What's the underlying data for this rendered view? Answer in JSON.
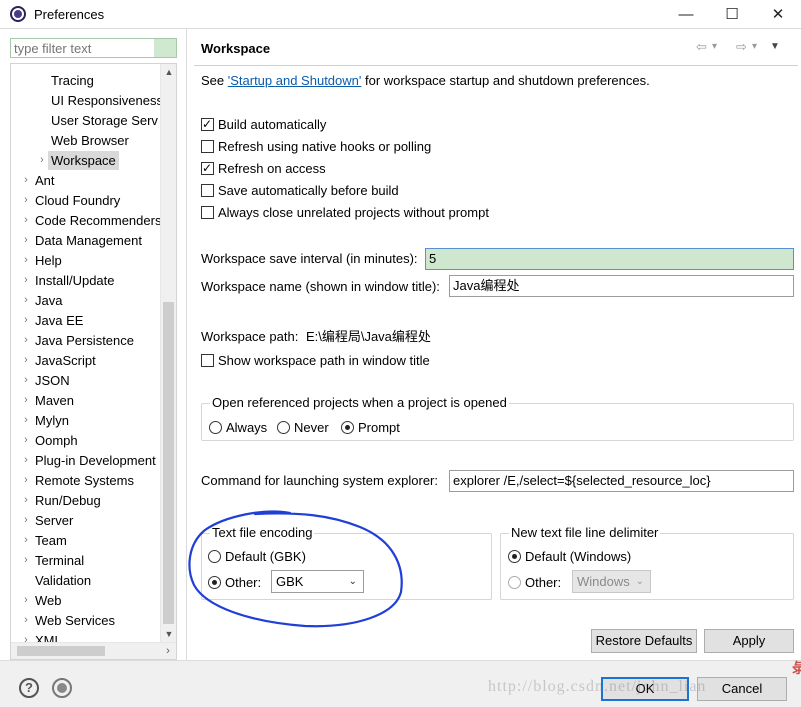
{
  "window": {
    "title": "Preferences",
    "minimize_glyph": "—",
    "maximize_glyph": "☐",
    "close_glyph": "✕"
  },
  "filter": {
    "placeholder": "type filter text"
  },
  "tree": {
    "items": [
      {
        "label": "Tracing",
        "level": 2,
        "expandable": false
      },
      {
        "label": "UI Responsiveness",
        "level": 2,
        "expandable": false
      },
      {
        "label": "User Storage Serv",
        "level": 2,
        "expandable": false
      },
      {
        "label": "Web Browser",
        "level": 2,
        "expandable": false
      },
      {
        "label": "Workspace",
        "level": 2,
        "expandable": true,
        "selected": true
      },
      {
        "label": "Ant",
        "level": 1,
        "expandable": true
      },
      {
        "label": "Cloud Foundry",
        "level": 1,
        "expandable": true
      },
      {
        "label": "Code Recommenders",
        "level": 1,
        "expandable": true
      },
      {
        "label": "Data Management",
        "level": 1,
        "expandable": true
      },
      {
        "label": "Help",
        "level": 1,
        "expandable": true
      },
      {
        "label": "Install/Update",
        "level": 1,
        "expandable": true
      },
      {
        "label": "Java",
        "level": 1,
        "expandable": true
      },
      {
        "label": "Java EE",
        "level": 1,
        "expandable": true
      },
      {
        "label": "Java Persistence",
        "level": 1,
        "expandable": true
      },
      {
        "label": "JavaScript",
        "level": 1,
        "expandable": true
      },
      {
        "label": "JSON",
        "level": 1,
        "expandable": true
      },
      {
        "label": "Maven",
        "level": 1,
        "expandable": true
      },
      {
        "label": "Mylyn",
        "level": 1,
        "expandable": true
      },
      {
        "label": "Oomph",
        "level": 1,
        "expandable": true
      },
      {
        "label": "Plug-in Development",
        "level": 1,
        "expandable": true
      },
      {
        "label": "Remote Systems",
        "level": 1,
        "expandable": true
      },
      {
        "label": "Run/Debug",
        "level": 1,
        "expandable": true
      },
      {
        "label": "Server",
        "level": 1,
        "expandable": true
      },
      {
        "label": "Team",
        "level": 1,
        "expandable": true
      },
      {
        "label": "Terminal",
        "level": 1,
        "expandable": true
      },
      {
        "label": "Validation",
        "level": 1,
        "expandable": false
      },
      {
        "label": "Web",
        "level": 1,
        "expandable": true
      },
      {
        "label": "Web Services",
        "level": 1,
        "expandable": true
      },
      {
        "label": "XML",
        "level": 1,
        "expandable": true
      }
    ]
  },
  "page": {
    "title": "Workspace",
    "see_prefix": "See ",
    "see_link": "'Startup and Shutdown'",
    "see_suffix": " for workspace startup and shutdown preferences.",
    "checkboxes": [
      {
        "label": "Build automatically",
        "checked": true
      },
      {
        "label": "Refresh using native hooks or polling",
        "checked": false
      },
      {
        "label": "Refresh on access",
        "checked": true
      },
      {
        "label": "Save automatically before build",
        "checked": false
      },
      {
        "label": "Always close unrelated projects without prompt",
        "checked": false
      }
    ],
    "save_interval_label": "Workspace save interval (in minutes):",
    "save_interval_value": "5",
    "workspace_name_label": "Workspace name (shown in window title):",
    "workspace_name_value": "Java编程处",
    "workspace_path_label": "Workspace path:",
    "workspace_path_value": "E:\\编程局\\Java编程处",
    "show_path_label": "Show workspace path in window title",
    "show_path_checked": false,
    "open_referenced": {
      "legend": "Open referenced projects when a project is opened",
      "options": [
        "Always",
        "Never",
        "Prompt"
      ],
      "selected": "Prompt"
    },
    "explorer_label": "Command for launching system explorer:",
    "explorer_value": "explorer /E,/select=${selected_resource_loc}",
    "encoding": {
      "legend": "Text file encoding",
      "default_label": "Default (GBK)",
      "other_label": "Other:",
      "selected": "Other",
      "other_value": "GBK"
    },
    "line_delimiter": {
      "legend": "New text file line delimiter",
      "default_label": "Default (Windows)",
      "other_label": "Other:",
      "selected": "Default",
      "other_value": "Windows"
    },
    "restore_defaults_label": "Restore Defaults",
    "apply_label": "Apply"
  },
  "footer": {
    "ok_label": "OK",
    "cancel_label": "Cancel",
    "watermark": "http://blog.csdn.net/john_lian",
    "edge_char": "彔"
  },
  "colors": {
    "link": "#0b5cad",
    "focused_field_bg": "#cfe7cf",
    "annotation_stroke": "#1f3fd6",
    "default_button_border": "#1b73d3"
  }
}
